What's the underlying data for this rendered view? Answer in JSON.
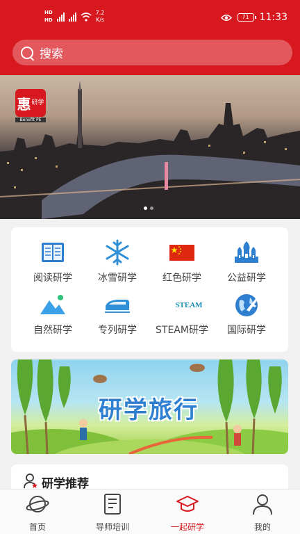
{
  "status_bar": {
    "hd_top": "HD",
    "hd_bottom": "HD",
    "net_speed_value": "7.2",
    "net_speed_unit": "K/s",
    "battery": "71",
    "time": "11:33"
  },
  "search": {
    "placeholder": "搜索"
  },
  "banner": {
    "logo_main": "惠",
    "logo_side": "研学",
    "logo_sub": "Benefit PE",
    "slide_count": 2,
    "active_slide": 0
  },
  "categories": [
    {
      "label": "阅读研学",
      "icon": "book-icon"
    },
    {
      "label": "冰雪研学",
      "icon": "snowflake-icon"
    },
    {
      "label": "红色研学",
      "icon": "china-flag-icon"
    },
    {
      "label": "公益研学",
      "icon": "palace-icon"
    },
    {
      "label": "自然研学",
      "icon": "mountain-icon"
    },
    {
      "label": "专列研学",
      "icon": "train-icon"
    },
    {
      "label": "STEAM研学",
      "icon": "steam-icon",
      "icon_text": "STEAM"
    },
    {
      "label": "国际研学",
      "icon": "globe-plane-icon"
    }
  ],
  "promo": {
    "title": "研学旅行"
  },
  "recommend": {
    "title": "研学推荐"
  },
  "tabs": [
    {
      "label": "首页",
      "icon": "planet-icon",
      "active": false
    },
    {
      "label": "导师培训",
      "icon": "clipboard-icon",
      "active": false
    },
    {
      "label": "一起研学",
      "icon": "graduation-cap-icon",
      "active": true
    },
    {
      "label": "我的",
      "icon": "person-icon",
      "active": false
    }
  ],
  "colors": {
    "brand_red": "#d8181f",
    "accent_blue": "#2f7fd1"
  }
}
